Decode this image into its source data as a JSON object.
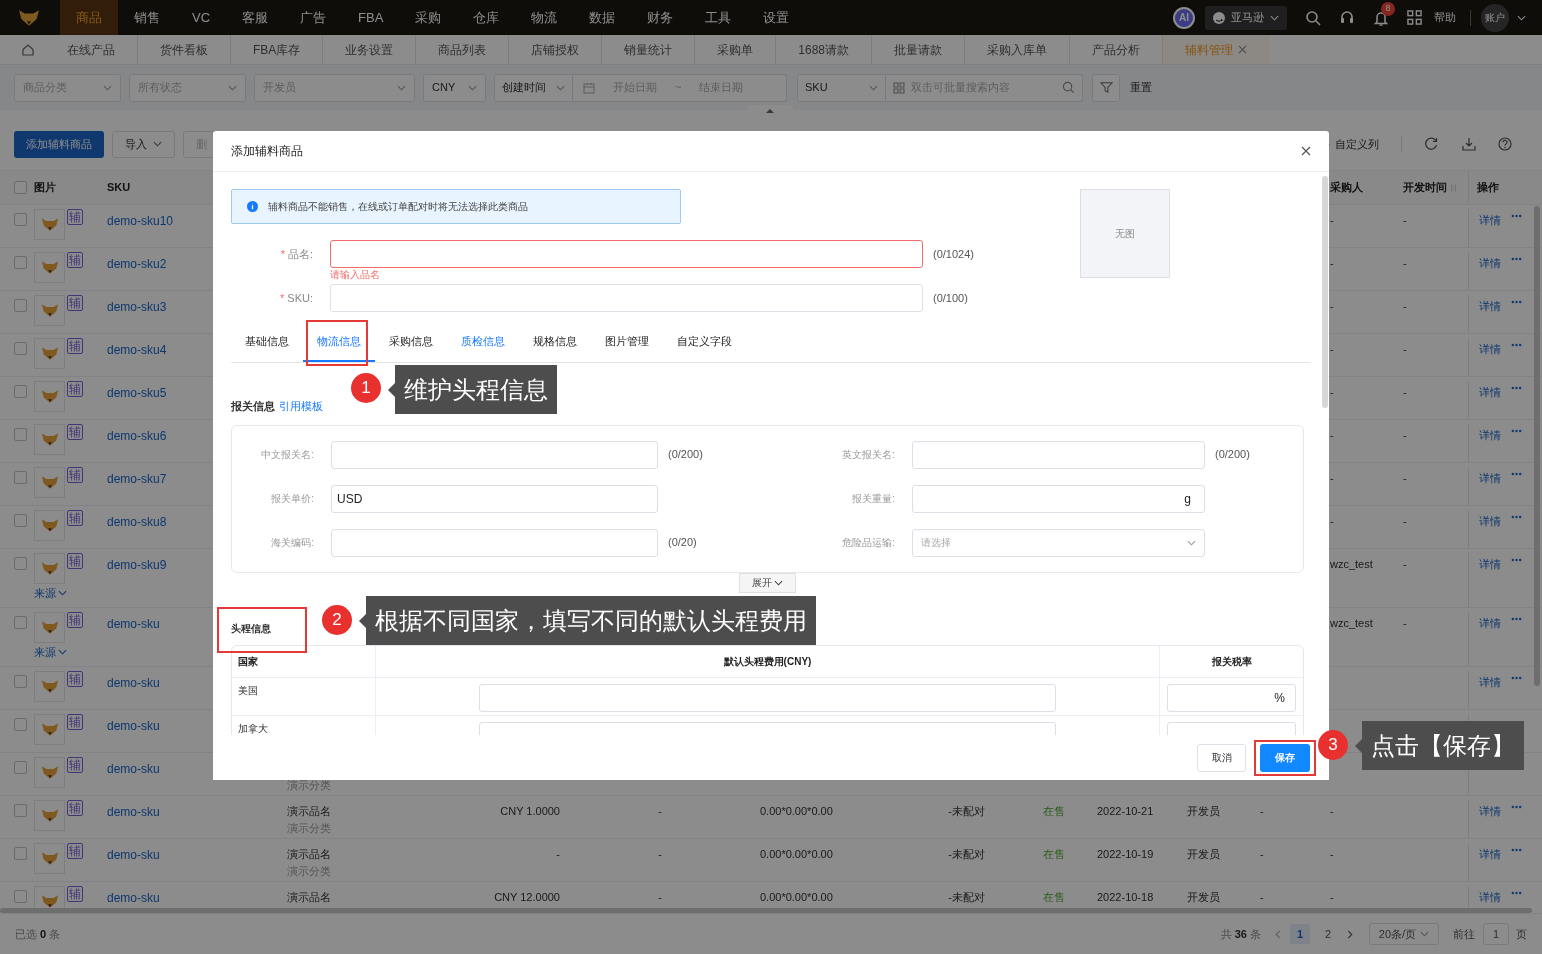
{
  "nav": {
    "menu": [
      {
        "label": "商品",
        "selected": true
      },
      {
        "label": "销售",
        "selected": false
      },
      {
        "label": "VC",
        "selected": false
      },
      {
        "label": "客服",
        "selected": false
      },
      {
        "label": "广告",
        "selected": false
      },
      {
        "label": "FBA",
        "selected": false
      },
      {
        "label": "采购",
        "selected": false
      },
      {
        "label": "仓库",
        "selected": false
      },
      {
        "label": "物流",
        "selected": false
      },
      {
        "label": "数据",
        "selected": false
      },
      {
        "label": "财务",
        "selected": false
      },
      {
        "label": "工具",
        "selected": false
      },
      {
        "label": "设置",
        "selected": false
      }
    ],
    "ai": "AI",
    "store": "亚马逊",
    "notifications": "8",
    "help": "帮助",
    "account": "账户"
  },
  "tabs": [
    {
      "label": "在线产品",
      "selected": false
    },
    {
      "label": "货件看板",
      "selected": false
    },
    {
      "label": "FBA库存",
      "selected": false
    },
    {
      "label": "业务设置",
      "selected": false
    },
    {
      "label": "商品列表",
      "selected": false
    },
    {
      "label": "店铺授权",
      "selected": false
    },
    {
      "label": "销量统计",
      "selected": false
    },
    {
      "label": "采购单",
      "selected": false
    },
    {
      "label": "1688请款",
      "selected": false
    },
    {
      "label": "批量请款",
      "selected": false
    },
    {
      "label": "采购入库单",
      "selected": false
    },
    {
      "label": "产品分析",
      "selected": false
    },
    {
      "label": "辅料管理",
      "selected": true
    }
  ],
  "filters": [
    {
      "kind": "select",
      "placeholder": "商品分类"
    },
    {
      "kind": "select",
      "placeholder": "所有状态"
    },
    {
      "kind": "select",
      "placeholder": "开发员"
    },
    {
      "kind": "select",
      "value": "CNY"
    },
    {
      "kind": "date_range",
      "type": "创建时间",
      "start": "开始日期",
      "separator": "~",
      "end": "结束日期"
    },
    {
      "kind": "search",
      "type": "SKU",
      "placeholder": "双击可批量搜索内容"
    },
    {
      "kind": "reset",
      "label": "重置"
    }
  ],
  "toolbar": {
    "add": "添加辅料商品",
    "import": "导入",
    "delete": "删",
    "columns": "自定义列"
  },
  "table": {
    "header_checkbox": {
      "checked": false
    },
    "columns": {
      "image": "图片",
      "sku": "SKU",
      "buyer": "采购人",
      "dev_time": "开发时间",
      "action": "操作"
    },
    "rows": [
      {
        "checked": false,
        "tag": "辅",
        "sku": "demo-sku10",
        "buyer": "-",
        "dev_time": "-",
        "details": "详情"
      },
      {
        "checked": false,
        "tag": "辅",
        "sku": "demo-sku2",
        "buyer": "-",
        "dev_time": "-",
        "details": "详情"
      },
      {
        "checked": false,
        "tag": "辅",
        "sku": "demo-sku3",
        "buyer": "-",
        "dev_time": "-",
        "details": "详情"
      },
      {
        "checked": false,
        "tag": "辅",
        "sku": "demo-sku4",
        "buyer": "-",
        "dev_time": "-",
        "details": "详情"
      },
      {
        "checked": false,
        "tag": "辅",
        "sku": "demo-sku5",
        "buyer": "-",
        "dev_time": "-",
        "details": "详情"
      },
      {
        "checked": false,
        "tag": "辅",
        "sku": "demo-sku6",
        "buyer": "-",
        "dev_time": "-",
        "details": "详情"
      },
      {
        "checked": false,
        "tag": "辅",
        "sku": "demo-sku7",
        "buyer": "-",
        "dev_time": "-",
        "details": "详情"
      },
      {
        "checked": false,
        "tag": "辅",
        "sku": "demo-sku8",
        "buyer": "-",
        "dev_time": "-",
        "details": "详情"
      },
      {
        "checked": false,
        "tag": "辅",
        "sku": "demo-sku9",
        "source": "来源",
        "buyer": "wzc_test",
        "dev_time": "-",
        "details": "详情"
      },
      {
        "checked": false,
        "tag": "辅",
        "sku": "demo-sku",
        "source": "来源",
        "buyer": "wzc_test",
        "dev_time": "-",
        "details": "详情"
      },
      {
        "checked": false,
        "tag": "辅",
        "sku": "demo-sku",
        "details": "详情"
      },
      {
        "checked": false,
        "tag": "辅",
        "sku": "demo-sku"
      },
      {
        "checked": false,
        "tag": "辅",
        "sku": "demo-sku",
        "category": "演示分类"
      },
      {
        "checked": false,
        "tag": "辅",
        "sku": "demo-sku",
        "name": "演示品名",
        "category": "演示分类",
        "price": "CNY 1.0000",
        "col_6": "-",
        "size": "0.00*0.00*0.00",
        "col_8": "-",
        "match": "未配对",
        "sale_status": "在售",
        "date": "2022-10-21",
        "developer": "开发员",
        "col_12": "-",
        "buyer": "-",
        "details": "详情"
      },
      {
        "checked": false,
        "tag": "辅",
        "sku": "demo-sku",
        "name": "演示品名",
        "category": "演示分类",
        "price": "-",
        "col_6": "-",
        "size": "0.00*0.00*0.00",
        "col_8": "-",
        "match": "未配对",
        "sale_status": "在售",
        "date": "2022-10-19",
        "developer": "开发员",
        "col_12": "-",
        "buyer": "-",
        "details": "详情"
      },
      {
        "checked": false,
        "tag": "辅",
        "sku": "demo-sku",
        "name": "演示品名",
        "price": "CNY 12.0000",
        "col_6": "-",
        "size": "0.00*0.00*0.00",
        "col_8": "-",
        "match": "未配对",
        "sale_status": "在售",
        "date": "2022-10-18",
        "developer": "开发员",
        "col_12": "-",
        "buyer": "-",
        "details": "详情"
      }
    ]
  },
  "footer": {
    "selected_prefix": "已选",
    "selected_count": "0",
    "selected_suffix": "条",
    "total_prefix": "共",
    "total": "36",
    "total_suffix": "条",
    "pages": [
      {
        "label": "1",
        "selected": true
      },
      {
        "label": "2",
        "selected": false
      }
    ],
    "page_size": "20条/页",
    "goto": "前往",
    "goto_value": "1",
    "goto_suffix": "页"
  },
  "modal": {
    "title": "添加辅料商品",
    "alert": "辅料商品不能销售，在线或订单配对时将无法选择此类商品",
    "image_placeholder": "无图",
    "fields": [
      {
        "mark": "*",
        "label": "品名:",
        "count": "(0/1024)",
        "error": "请输入品名"
      },
      {
        "mark": "*",
        "label": "SKU:",
        "count": "(0/100)"
      }
    ],
    "tabs": [
      {
        "label": "基础信息",
        "selected": false,
        "highlighted": false
      },
      {
        "label": "物流信息",
        "selected": true,
        "highlighted": true
      },
      {
        "label": "采购信息",
        "selected": false,
        "highlighted": false
      },
      {
        "label": "质检信息",
        "selected": false,
        "highlighted": true
      },
      {
        "label": "规格信息",
        "selected": false,
        "highlighted": false
      },
      {
        "label": "图片管理",
        "selected": false,
        "highlighted": false
      },
      {
        "label": "自定义字段",
        "selected": false,
        "highlighted": false
      }
    ],
    "customs": {
      "title": "报关信息",
      "link": "引用模板",
      "fields": [
        {
          "kind": "input",
          "label": "中文报关名:",
          "count": "(0/200)"
        },
        {
          "kind": "input",
          "label": "英文报关名:",
          "count": "(0/200)"
        },
        {
          "kind": "input",
          "label": "报关单价:",
          "value": "USD"
        },
        {
          "kind": "input",
          "label": "报关重量:",
          "suffix": "g"
        },
        {
          "kind": "input",
          "label": "海关编码:",
          "count": "(0/20)"
        },
        {
          "kind": "select",
          "label": "危险品运输:",
          "placeholder": "请选择"
        }
      ],
      "expand": "展开"
    },
    "freight": {
      "title": "头程信息",
      "columns": [
        "国家",
        "默认头程费用(CNY)",
        "报关税率"
      ],
      "rows": [
        {
          "country": "美国",
          "rate_suffix": "%"
        },
        {
          "country": "加拿大"
        }
      ]
    },
    "cancel": "取消",
    "save": "保存"
  },
  "annotations": [
    {
      "number": "1",
      "text": "维护头程信息"
    },
    {
      "number": "2",
      "text": "根据不同国家，填写不同的默认头程费用"
    },
    {
      "number": "3",
      "text": "点击【保存】"
    }
  ]
}
